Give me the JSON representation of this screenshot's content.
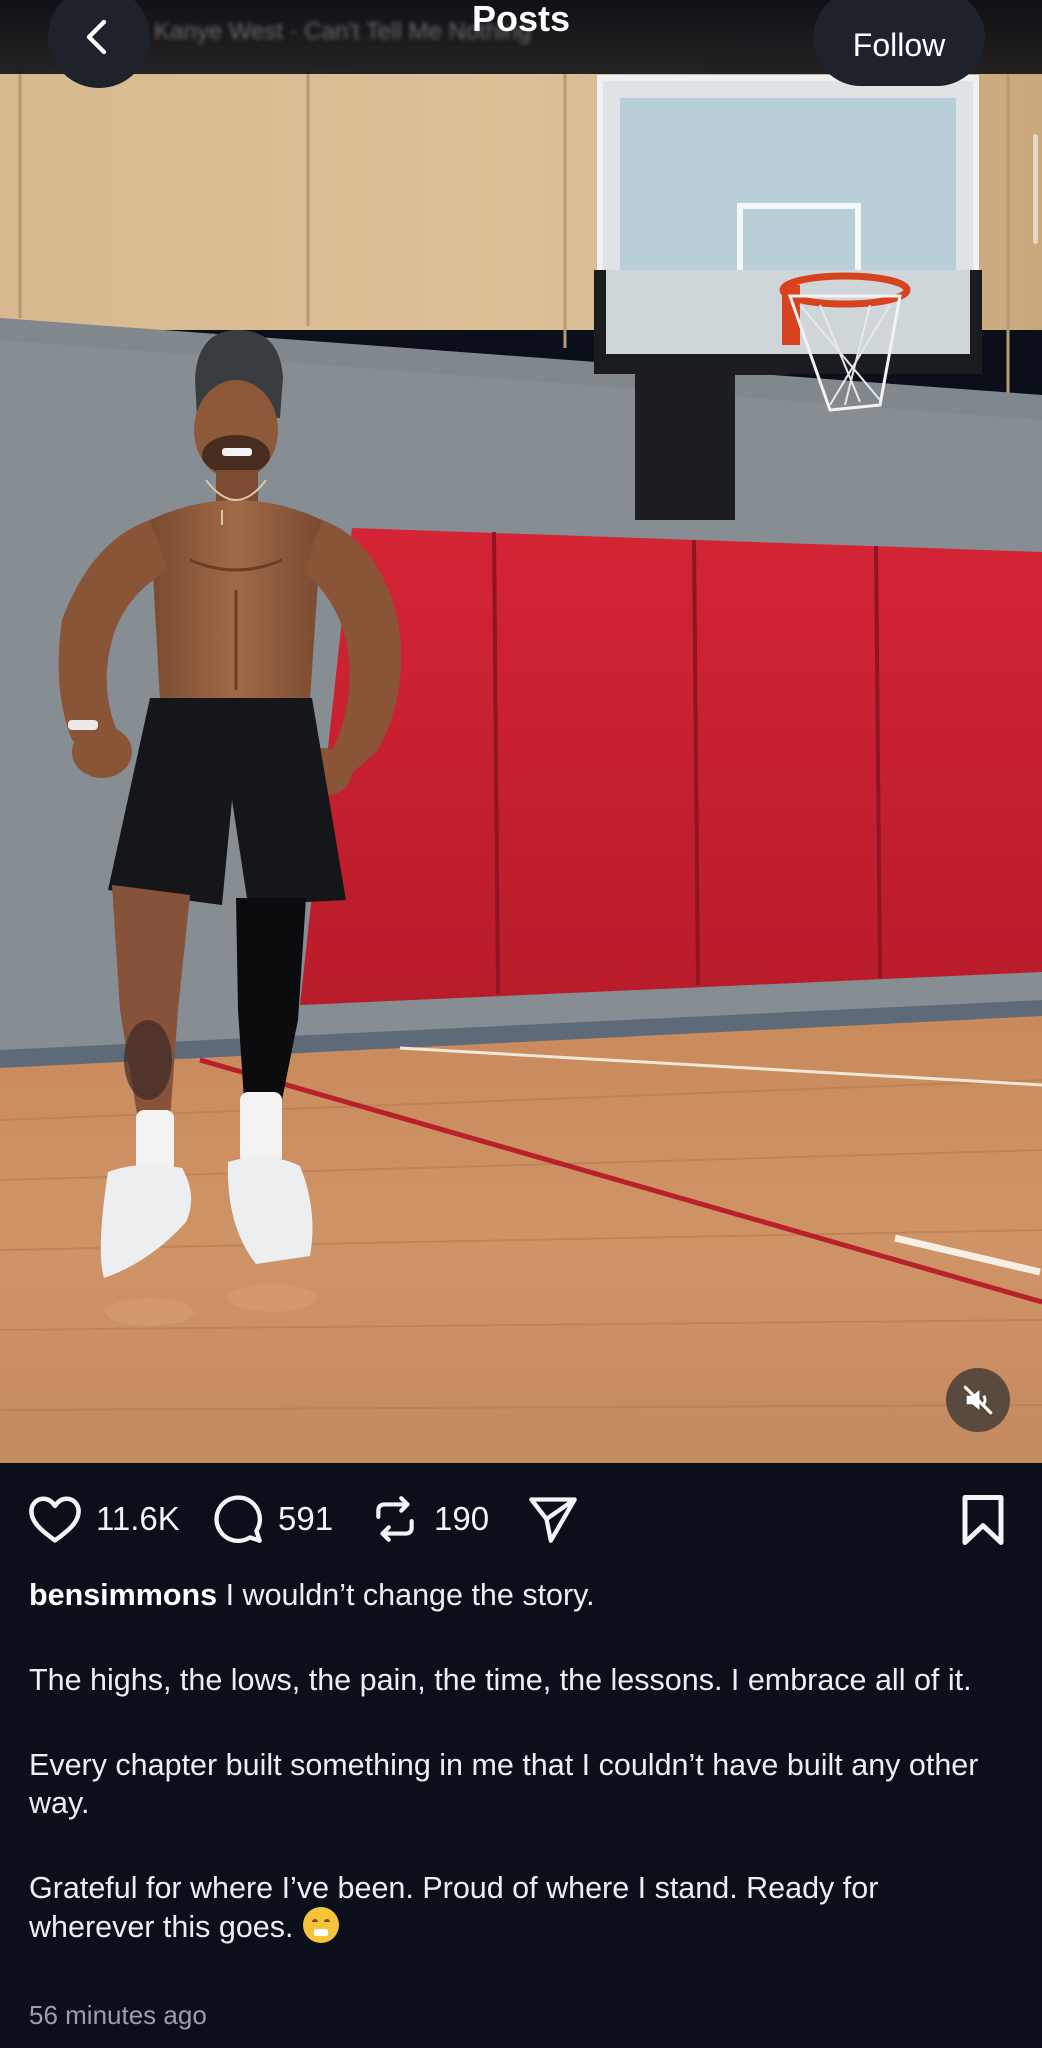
{
  "header": {
    "title": "Posts",
    "follow_label": "Follow",
    "music_text": "Kanye West · Can't Tell Me Nothing"
  },
  "actions": {
    "likes": "11.6K",
    "comments": "591",
    "reposts": "190"
  },
  "caption": {
    "username": "bensimmons",
    "first_line": " I wouldn’t change the story.",
    "paragraph_2": "The highs, the lows, the pain, the time, the lessons. I embrace all of it.",
    "paragraph_3": "Every chapter built something in me that I couldn’t have built any other way.",
    "paragraph_4": "Grateful for where I’ve been. Proud of where I stand. Ready for wherever this goes."
  },
  "timestamp": "56 minutes ago",
  "icons": {
    "back": "chevron-left-icon",
    "like": "heart-icon",
    "comment": "comment-icon",
    "repost": "repost-icon",
    "share": "send-icon",
    "save": "bookmark-icon",
    "mute": "speaker-muted-icon"
  },
  "colors": {
    "background": "#0b0f1a",
    "wall_pad": "#c8202f",
    "court_floor": "#c9875a"
  }
}
